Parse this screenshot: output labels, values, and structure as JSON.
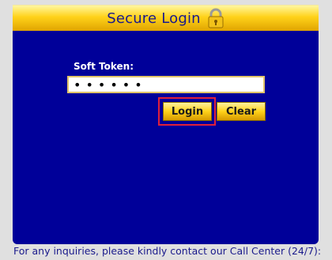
{
  "header": {
    "title": "Secure Login",
    "icon": "padlock-icon"
  },
  "form": {
    "token_label": "Soft Token:",
    "token_value": "••••••",
    "login_label": "Login",
    "clear_label": "Clear"
  },
  "footer": {
    "text": "For any inquiries, please kindly contact our Call Center (24/7):"
  },
  "colors": {
    "panel": "#000099",
    "header_gold": "#ffd21a",
    "title_text": "#1a1a8c",
    "highlight": "#e0203a"
  }
}
